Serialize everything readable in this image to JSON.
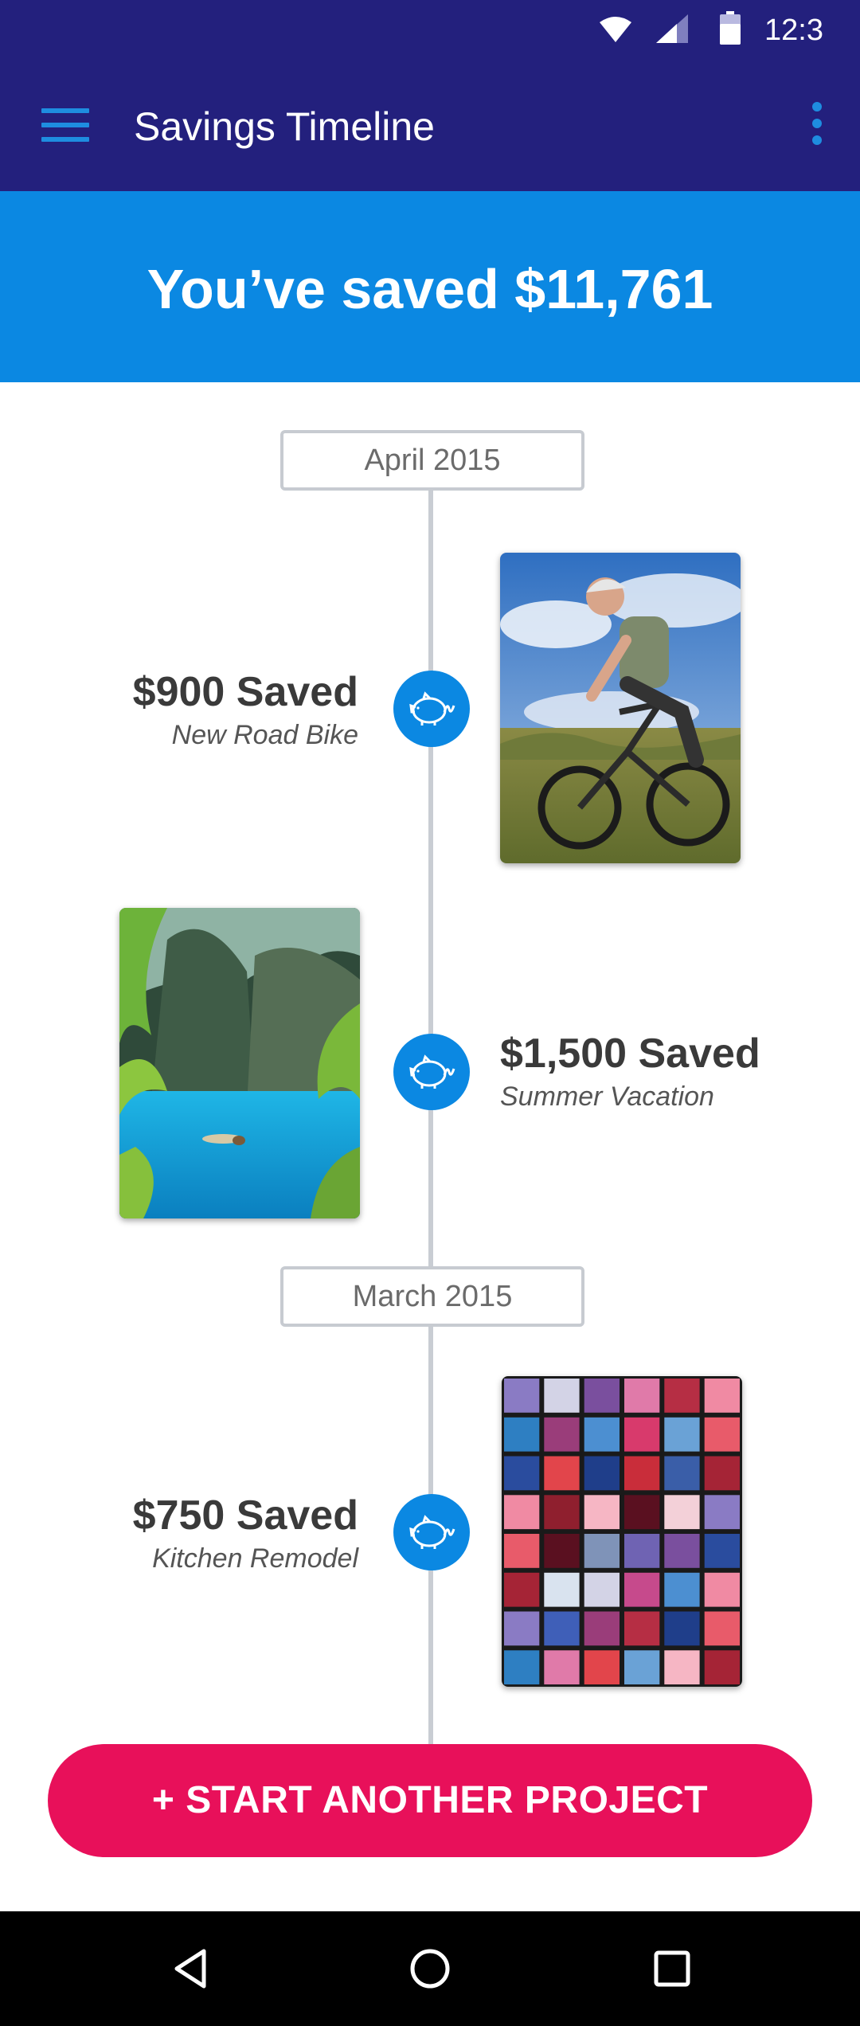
{
  "status_bar": {
    "time": "12:3",
    "icons": [
      "wifi-icon",
      "signal-icon",
      "battery-icon"
    ]
  },
  "app_bar": {
    "title": "Savings Timeline",
    "menu_icon": "hamburger-menu-icon",
    "overflow_icon": "more-vert-icon"
  },
  "banner": {
    "text": "You’ve saved $11,761"
  },
  "timeline": {
    "months": [
      {
        "label": "April 2015"
      },
      {
        "label": "March 2015"
      }
    ],
    "entries": [
      {
        "amount": "$900 Saved",
        "project": "New Road Bike",
        "icon": "piggy-bank-icon",
        "photo": "mountain-biker-photo"
      },
      {
        "amount": "$1,500 Saved",
        "project": "Summer Vacation",
        "icon": "piggy-bank-icon",
        "photo": "lagoon-photo"
      },
      {
        "amount": "$750 Saved",
        "project": "Kitchen Remodel",
        "icon": "piggy-bank-icon",
        "photo": "color-swatches-photo"
      }
    ]
  },
  "cta": {
    "label": "+ START ANOTHER PROJECT"
  },
  "nav_bar": {
    "icons": [
      "back-icon",
      "home-icon",
      "recents-icon"
    ]
  },
  "colors": {
    "app_bar": "#23207d",
    "banner": "#0b88e2",
    "accent_blue": "#1e8de0",
    "cta": "#e8105a",
    "timeline_line": "#c9cdd3"
  }
}
